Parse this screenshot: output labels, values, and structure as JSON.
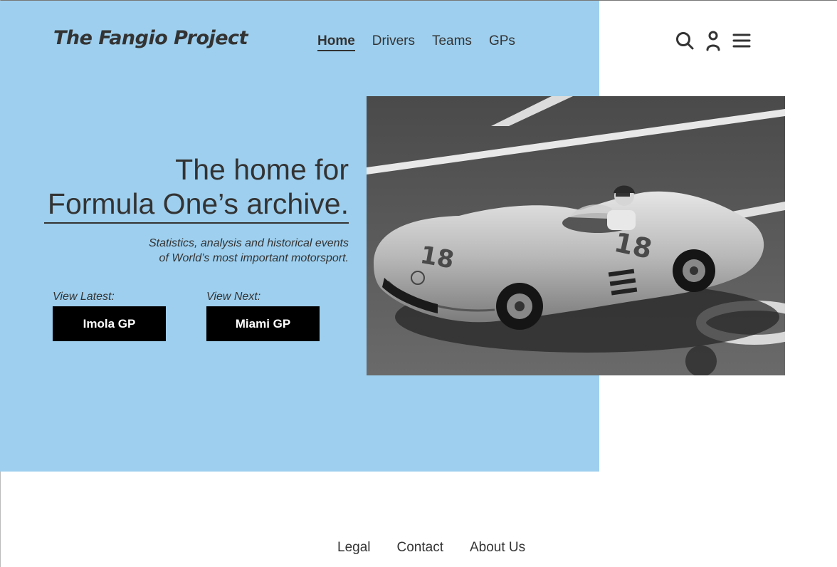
{
  "brand": {
    "logo_text": "The Fangio Project"
  },
  "nav": {
    "items": [
      {
        "label": "Home",
        "active": true
      },
      {
        "label": "Drivers",
        "active": false
      },
      {
        "label": "Teams",
        "active": false
      },
      {
        "label": "GPs",
        "active": false
      }
    ]
  },
  "header_icons": [
    "search-icon",
    "user-icon",
    "menu-icon"
  ],
  "hero": {
    "headline_line1": "The home for",
    "headline_line2": "Formula One’s archive.",
    "tagline_line1": "Statistics, analysis and historical events",
    "tagline_line2": "of World’s most important motorsport.",
    "latest": {
      "label": "View Latest:",
      "button": "Imola GP"
    },
    "next": {
      "label": "View Next:",
      "button": "Miami GP"
    },
    "photo_car_number": "18"
  },
  "footer": {
    "links": [
      "Legal",
      "Contact",
      "About Us"
    ]
  },
  "colors": {
    "hero_background": "#9ecfee",
    "text": "#333333",
    "button_background": "#000000",
    "button_text": "#ffffff"
  }
}
